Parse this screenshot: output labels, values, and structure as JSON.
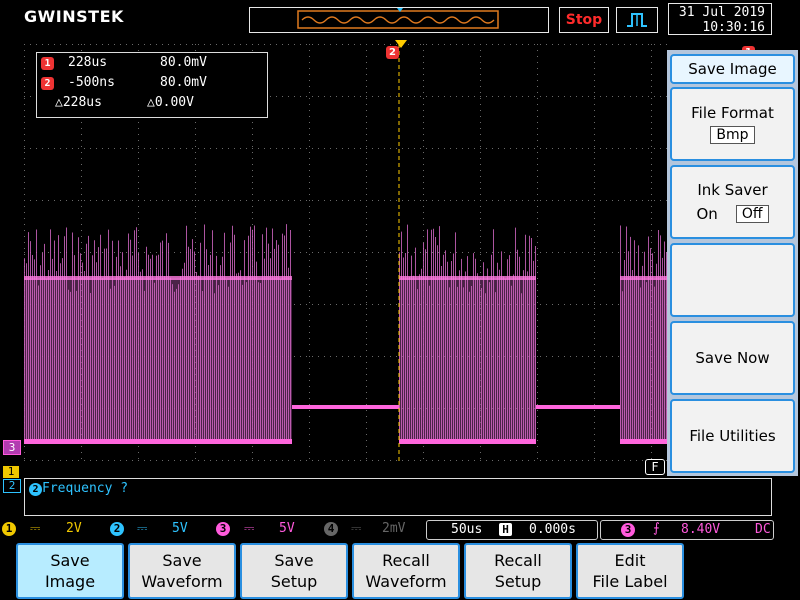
{
  "brand": "GWINSTEK",
  "top": {
    "stop_label": "Stop",
    "date": "31 Jul 2019",
    "time": "10:30:16"
  },
  "cursor": {
    "row1_id": "1",
    "row1_time": "228us",
    "row1_volt": "80.0mV",
    "row2_id": "2",
    "row2_time": "-500ns",
    "row2_volt": "80.0mV",
    "delta_time": "△228us",
    "delta_volt": "△0.00V"
  },
  "markers": {
    "ch3": "3",
    "ch1": "1",
    "ch2": "2",
    "trigger_top": "2",
    "right_top": "1",
    "filter": "F"
  },
  "menu": {
    "title": "Save Image",
    "file_format_label": "File Format",
    "file_format_value": "Bmp",
    "ink_saver_label": "Ink Saver",
    "ink_on": "On",
    "ink_off": "Off",
    "blank": "",
    "save_now": "Save Now",
    "file_utilities": "File Utilities"
  },
  "message": {
    "badge": "2",
    "text": "Frequency ?"
  },
  "status": {
    "ch1_num": "1",
    "ch1_value": "2V",
    "ch2_num": "2",
    "ch2_value": "5V",
    "ch3_num": "3",
    "ch3_value": "5V",
    "ch4_num": "4",
    "ch4_value": "2mV",
    "timebase": "50us",
    "h_position": "0.000s",
    "trig_source": "3",
    "trig_level": "8.40V",
    "coupling": "DC"
  },
  "softkeys": {
    "save_image": "Save\nImage",
    "save_waveform": "Save\nWaveform",
    "save_setup": "Save\nSetup",
    "recall_waveform": "Recall\nWaveform",
    "recall_setup": "Recall\nSetup",
    "edit_file_label": "Edit\nFile Label"
  },
  "colors": {
    "ch1": "#f0c800",
    "ch2": "#2ec3ff",
    "ch3": "#ff5adc",
    "ch4": "#666666",
    "accent": "#2a8fe0",
    "menu_bg": "#b4c6dc",
    "trace": "#d86ac8"
  }
}
